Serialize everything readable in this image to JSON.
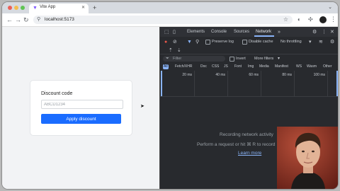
{
  "browser": {
    "tab_title": "Vite App",
    "url": "localhost:5173"
  },
  "page": {
    "label": "Discount code",
    "placeholder": "ABCD1234",
    "button": "Apply discount"
  },
  "devtools": {
    "tabs": [
      "Elements",
      "Console",
      "Sources",
      "Network"
    ],
    "active_tab": "Network",
    "preserve_log": "Preserve log",
    "disable_cache": "Disable cache",
    "throttling": "No throttling",
    "filter_placeholder": "Filter",
    "invert": "Invert",
    "more_filters": "More filters",
    "type_filters": [
      "All",
      "Fetch/XHR",
      "Doc",
      "CSS",
      "JS",
      "Font",
      "Img",
      "Media",
      "Manifest",
      "WS",
      "Wasm",
      "Other"
    ],
    "timeline_ticks": [
      "20 ms",
      "40 ms",
      "60 ms",
      "80 ms",
      "100 ms"
    ],
    "empty_line1": "Recording network activity",
    "empty_line2": "Perform a request or hit ⌘ R to record",
    "learn_more": "Learn more"
  },
  "colors": {
    "primary_button": "#1a6cff",
    "devtools_bg": "#282a2e",
    "devtools_accent": "#8ab4f8",
    "recording": "#e8574a"
  }
}
